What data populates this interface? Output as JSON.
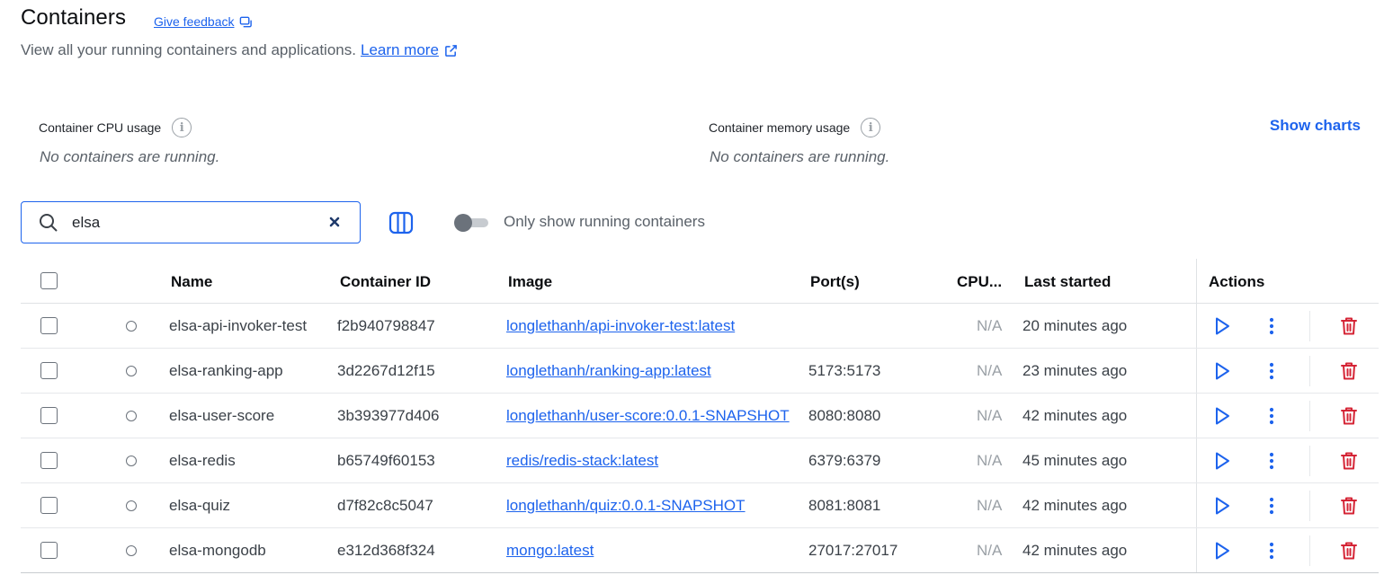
{
  "header": {
    "title": "Containers",
    "feedback_label": "Give feedback",
    "subtitle": "View all your running containers and applications.",
    "learn_more": "Learn more"
  },
  "stats": {
    "cpu_label": "Container CPU usage",
    "cpu_empty": "No containers are running.",
    "memory_label": "Container memory usage",
    "memory_empty": "No containers are running.",
    "show_charts": "Show charts"
  },
  "toolbar": {
    "search_value": "elsa",
    "running_toggle_label": "Only show running containers",
    "running_toggle_on": false
  },
  "table": {
    "columns": {
      "name": "Name",
      "container_id": "Container ID",
      "image": "Image",
      "ports": "Port(s)",
      "cpu": "CPU...",
      "last_started": "Last started",
      "actions": "Actions"
    },
    "rows": [
      {
        "name": "elsa-api-invoker-test",
        "id": "f2b940798847",
        "image": "longlethanh/api-invoker-test:latest",
        "ports": "",
        "cpu": "N/A",
        "last_started": "20 minutes ago"
      },
      {
        "name": "elsa-ranking-app",
        "id": "3d2267d12f15",
        "image": "longlethanh/ranking-app:latest",
        "ports": "5173:5173",
        "cpu": "N/A",
        "last_started": "23 minutes ago"
      },
      {
        "name": "elsa-user-score",
        "id": "3b393977d406",
        "image": "longlethanh/user-score:0.0.1-SNAPSHOT",
        "ports": "8080:8080",
        "cpu": "N/A",
        "last_started": "42 minutes ago"
      },
      {
        "name": "elsa-redis",
        "id": "b65749f60153",
        "image": "redis/redis-stack:latest",
        "ports": "6379:6379",
        "cpu": "N/A",
        "last_started": "45 minutes ago"
      },
      {
        "name": "elsa-quiz",
        "id": "d7f82c8c5047",
        "image": "longlethanh/quiz:0.0.1-SNAPSHOT",
        "ports": "8081:8081",
        "cpu": "N/A",
        "last_started": "42 minutes ago"
      },
      {
        "name": "elsa-mongodb",
        "id": "e312d368f324",
        "image": "mongo:latest",
        "ports": "27017:27017",
        "cpu": "N/A",
        "last_started": "42 minutes ago"
      }
    ]
  },
  "icons": {
    "play": "play-icon",
    "more": "more-vertical-icon",
    "delete": "trash-icon",
    "status": "stopped-status-icon"
  },
  "colors": {
    "accent": "#1d63ed",
    "danger": "#d52536",
    "muted": "#6b727b"
  }
}
